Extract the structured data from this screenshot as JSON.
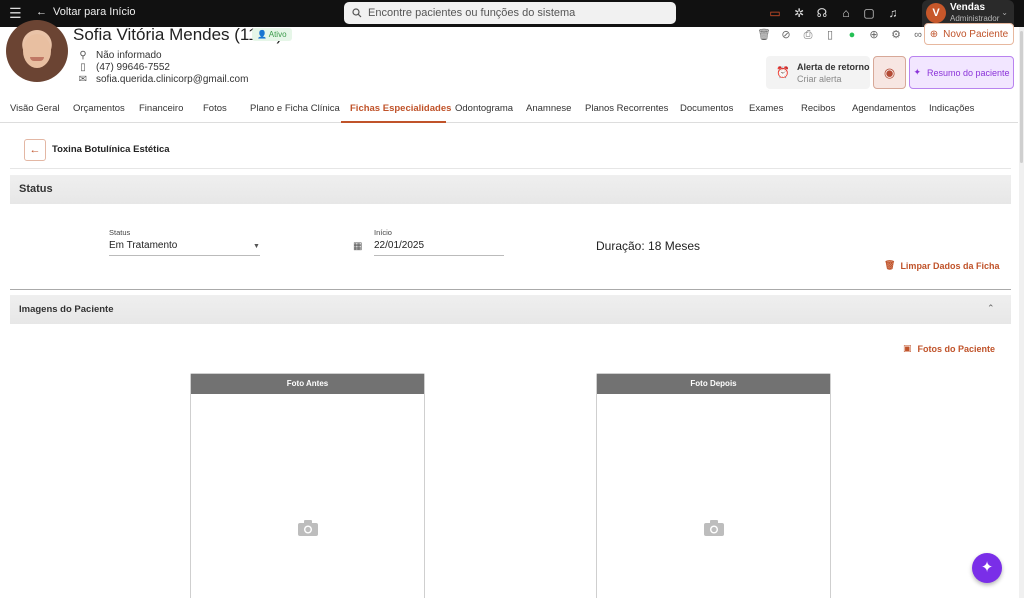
{
  "topbar": {
    "back_label": "Voltar para Início",
    "search_placeholder": "Encontre pacientes ou funções do sistema",
    "user": {
      "initial": "V",
      "name": "Vendas",
      "role": "Administrador"
    }
  },
  "patient": {
    "name": "Sofia Vitória Mendes (1120)",
    "status_badge": "Ativo",
    "address": "Não informado",
    "phone": "(47) 99646-7552",
    "email": "sofia.querida.clinicorp@gmail.com"
  },
  "actions": {
    "novo_paciente": "Novo Paciente",
    "alerta_title": "Alerta de retorno",
    "alerta_sub": "Criar alerta",
    "resumo": "Resumo do paciente"
  },
  "tabs": [
    {
      "label": "Visão Geral"
    },
    {
      "label": "Orçamentos"
    },
    {
      "label": "Financeiro"
    },
    {
      "label": "Fotos"
    },
    {
      "label": "Plano e Ficha Clínica"
    },
    {
      "label": "Fichas Especialidades"
    },
    {
      "label": "Odontograma"
    },
    {
      "label": "Anamnese"
    },
    {
      "label": "Planos Recorrentes"
    },
    {
      "label": "Documentos"
    },
    {
      "label": "Exames"
    },
    {
      "label": "Recibos"
    },
    {
      "label": "Agendamentos"
    },
    {
      "label": "Indicações"
    }
  ],
  "active_tab": "Fichas Especialidades",
  "ficha": {
    "title": "Toxina Botulínica Estética",
    "status_section": "Status",
    "status_label": "Status",
    "status_value": "Em Tratamento",
    "inicio_label": "Início",
    "inicio_value": "22/01/2025",
    "duracao": "Duração: 18 Meses",
    "limpar": "Limpar Dados da Ficha",
    "imagens_section": "Imagens do Paciente",
    "fotos_link": "Fotos do Paciente",
    "foto_antes": "Foto Antes",
    "foto_depois": "Foto Depois"
  },
  "colors": {
    "accent": "#c0532a",
    "purple": "#8b33d9",
    "fab": "#7a2ee8"
  }
}
